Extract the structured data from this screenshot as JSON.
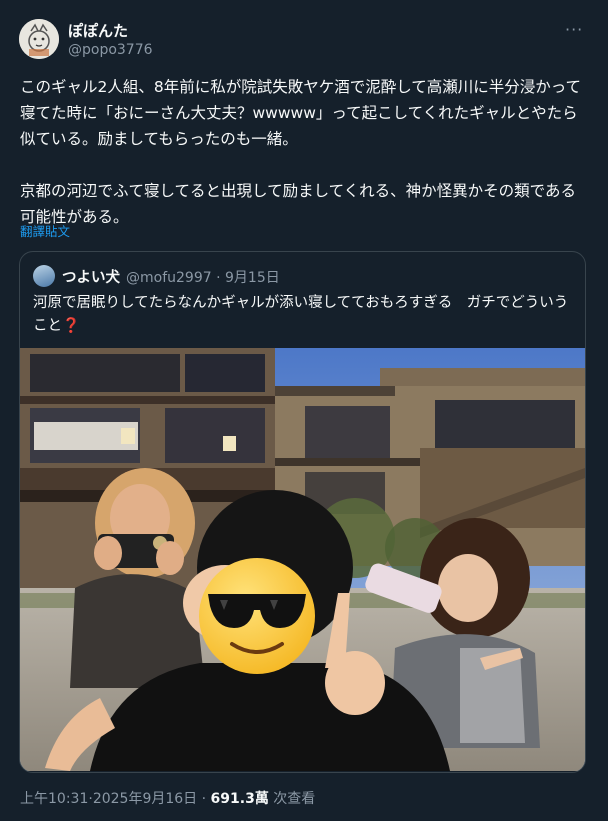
{
  "author": {
    "name": "ぽぽんた",
    "handle": "@popo3776"
  },
  "more_label": "···",
  "tweet": {
    "text": "このギャル2人組、8年前に私が院試失敗ヤケ酒で泥酔して高瀬川に半分浸かって寝てた時に「おにーさん大丈夫？wwwww」って起こしてくれたギャルとやたら似ている。励ましてもらったのも一緒。\n\n京都の河辺でふて寝してると出現して励ましてくれる、神か怪異かその類である可能性がある。",
    "translate_label": "翻譯貼文"
  },
  "quoted": {
    "name": "つよい犬",
    "handle": "@mofu2997",
    "date": "9月15日",
    "meta_separator": "·",
    "text": "河原で居眠りしてたらなんかギャルが添い寝してておもろすぎる　ガチでどういうこと",
    "emoji": "❓"
  },
  "footer": {
    "time": "上午10:31",
    "date": "2025年9月16日",
    "separator": "·",
    "views_count": "691.3萬",
    "views_label": "次查看"
  },
  "colors": {
    "background": "#15202b",
    "text": "#f7f9f9",
    "muted": "#8b98a5",
    "link": "#1d9bf0",
    "border": "#38444d"
  }
}
